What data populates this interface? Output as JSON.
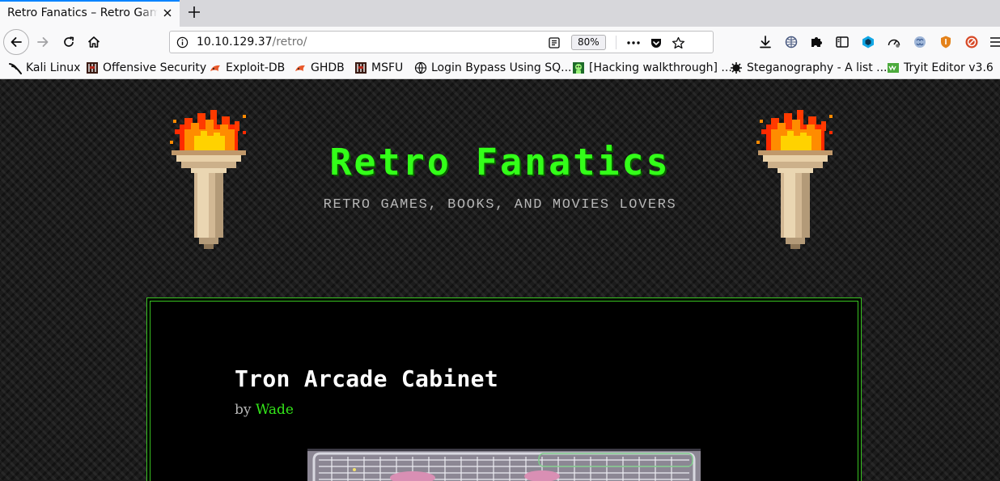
{
  "browser": {
    "tab": {
      "title": "Retro Fanatics – Retro Games, Books, and Movies Lovers",
      "close_icon": "close-icon"
    },
    "new_tab_icon": "plus-icon",
    "nav": {
      "back_icon": "back-arrow-icon",
      "forward_icon": "forward-arrow-icon",
      "reload_icon": "reload-icon",
      "home_icon": "home-icon"
    },
    "url": {
      "host": "10.10.129.37",
      "path": "/retro/",
      "zoom": "80%"
    },
    "toolbar_icons": [
      "download-icon",
      "globe-extension-icon",
      "puzzle-extensions-icon",
      "sidebar-icon",
      "cube-extension-icon",
      "gauge-extension-icon",
      "brain-extension-icon",
      "shield-extension-icon",
      "blocker-extension-icon"
    ]
  },
  "bookmarks": [
    {
      "label": "Kali Linux",
      "icon": "kali-dragon-icon"
    },
    {
      "label": "Offensive Security",
      "icon": "offsec-icon"
    },
    {
      "label": "Exploit-DB",
      "icon": "exploitdb-icon"
    },
    {
      "label": "GHDB",
      "icon": "ghdb-icon"
    },
    {
      "label": "MSFU",
      "icon": "msfu-icon"
    },
    {
      "label": "Login Bypass Using SQ...",
      "icon": "globe-icon"
    },
    {
      "label": "[Hacking walkthrough] ...",
      "icon": "hacker-icon"
    },
    {
      "label": "Steganography - A list ...",
      "icon": "virus-icon"
    },
    {
      "label": "Tryit Editor v3.6",
      "icon": "w3-icon"
    }
  ],
  "page": {
    "site_title": "Retro Fanatics",
    "tagline": "RETRO GAMES, BOOKS, AND MOVIES LOVERS",
    "post": {
      "title": "Tron Arcade Cabinet",
      "by": "by",
      "author": "Wade"
    },
    "colors": {
      "accent": "#33ff19",
      "author": "#33e519",
      "frame": "#39c421",
      "background": "#1c1c1c"
    }
  }
}
